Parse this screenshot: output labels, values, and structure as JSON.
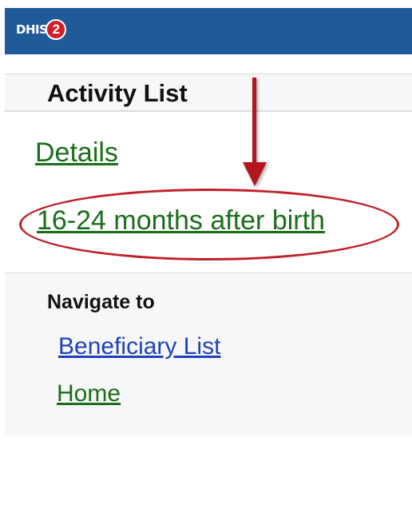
{
  "header": {
    "logo_text": "DHIS",
    "logo_badge": "2",
    "colors": {
      "bar": "#215a99",
      "badge": "#d21e2b"
    }
  },
  "activity_list": {
    "title": "Activity List",
    "items": [
      {
        "label": "Details"
      },
      {
        "label": "16-24 months after birth"
      }
    ]
  },
  "annotation": {
    "arrow_color": "#b3161f",
    "highlight_color": "#c0202a"
  },
  "navigate": {
    "heading": "Navigate to",
    "links": [
      {
        "label": "Beneficiary List"
      },
      {
        "label": "Home"
      }
    ]
  }
}
